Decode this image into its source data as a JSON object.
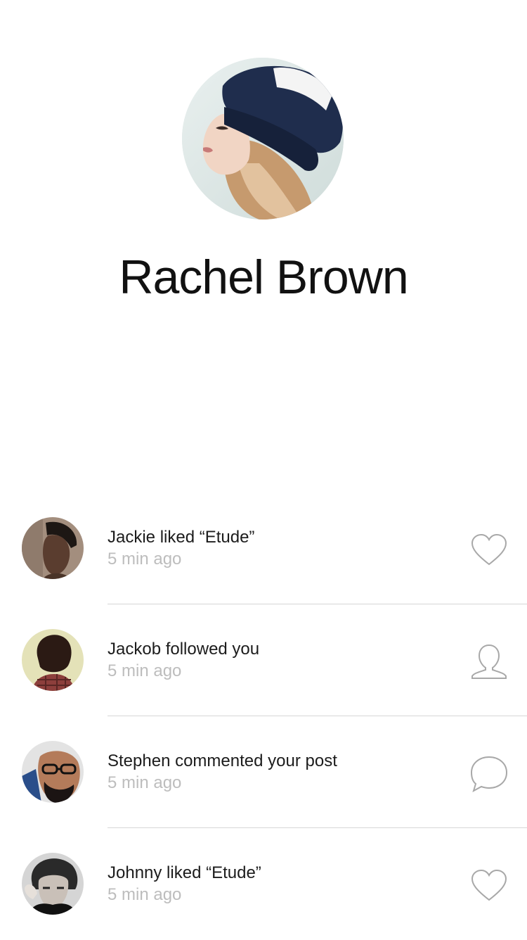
{
  "profile": {
    "name": "Rachel Brown"
  },
  "activity": [
    {
      "message": "Jackie liked “Etude”",
      "time": "5 min ago",
      "icon": "heart-icon"
    },
    {
      "message": "Jackob followed you",
      "time": "5 min ago",
      "icon": "user-icon"
    },
    {
      "message": "Stephen commented your post",
      "time": "5 min ago",
      "icon": "comment-icon"
    },
    {
      "message": "Johnny liked “Etude”",
      "time": "5 min ago",
      "icon": "heart-icon"
    }
  ],
  "colors": {
    "text": "#1c1c1c",
    "secondary_text": "#bdbdbd",
    "icon_stroke": "#a8a8a8",
    "divider": "#d6d6d6"
  }
}
